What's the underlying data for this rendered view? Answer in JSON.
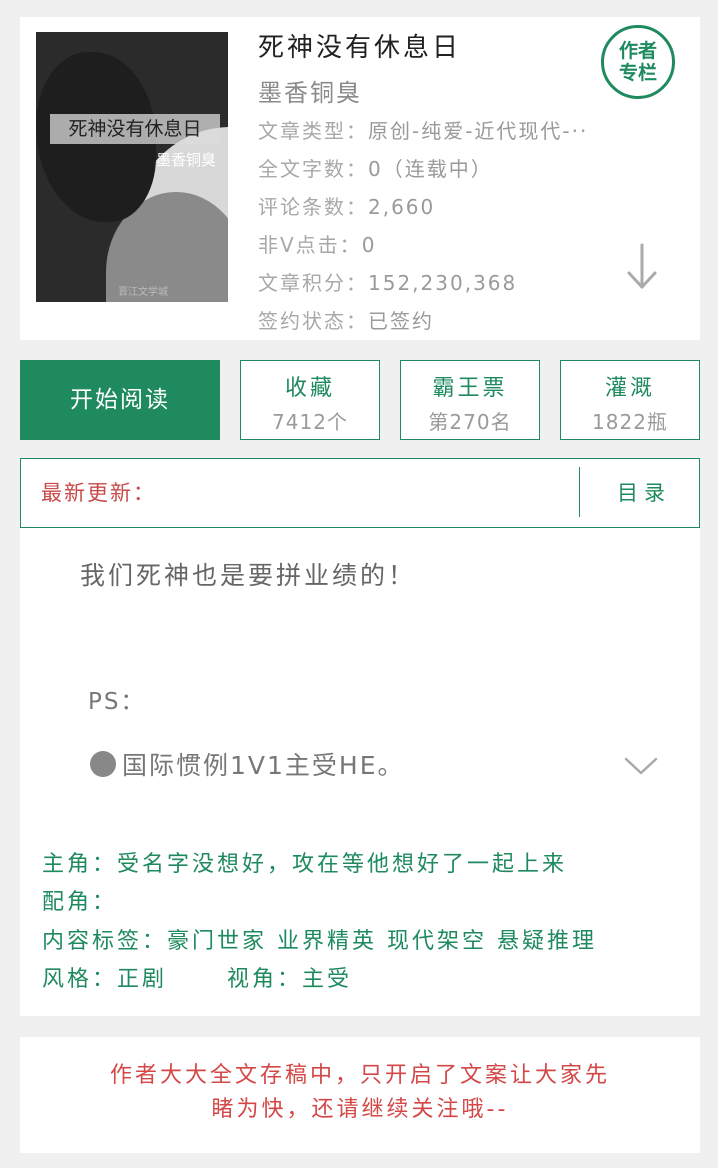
{
  "book": {
    "cover": {
      "title": "死神没有休息日",
      "author": "墨香铜臭",
      "publisher": "晋江文学城"
    },
    "title": "死神没有休息日",
    "author": "墨香铜臭",
    "author_badge": {
      "line1": "作者",
      "line2": "专栏"
    },
    "meta": [
      {
        "key": "文章类型：",
        "value": "原创-纯爱-近代现代-··"
      },
      {
        "key": "全文字数：",
        "value": "0（连载中）"
      },
      {
        "key": "评论条数：",
        "value": "2,660"
      },
      {
        "key": "非V点击：",
        "value": "0"
      },
      {
        "key": "文章积分：",
        "value": "152,230,368"
      },
      {
        "key": "签约状态：",
        "value": "已签约"
      }
    ]
  },
  "actions": {
    "read_label": "开始阅读",
    "favorite": {
      "label": "收藏",
      "value": "7412个"
    },
    "overlord": {
      "label": "霸王票",
      "value": "第270名"
    },
    "irrigate": {
      "label": "灌溉",
      "value": "1822瓶"
    }
  },
  "latest": {
    "label": "最新更新：",
    "toc_label": "目录"
  },
  "description": {
    "line1": "我们死神也是要拼业绩的！",
    "ps": "PS：",
    "bullet": "国际惯例1V1主受HE。"
  },
  "tags": {
    "main_roles": "主角：受名字没想好，攻在等他想好了一起上来",
    "supporting": "配角：",
    "content_tags": "内容标签：豪门世家 业界精英 现代架空 悬疑推理",
    "style": "风格：正剧      视角：主受"
  },
  "notice": {
    "line1": "作者大大全文存稿中，只开启了文案让大家先",
    "line2": "睹为快，还请继续关注哦--"
  },
  "colors": {
    "brand_green": "#1e8a5e",
    "notice_red": "#d34747"
  }
}
